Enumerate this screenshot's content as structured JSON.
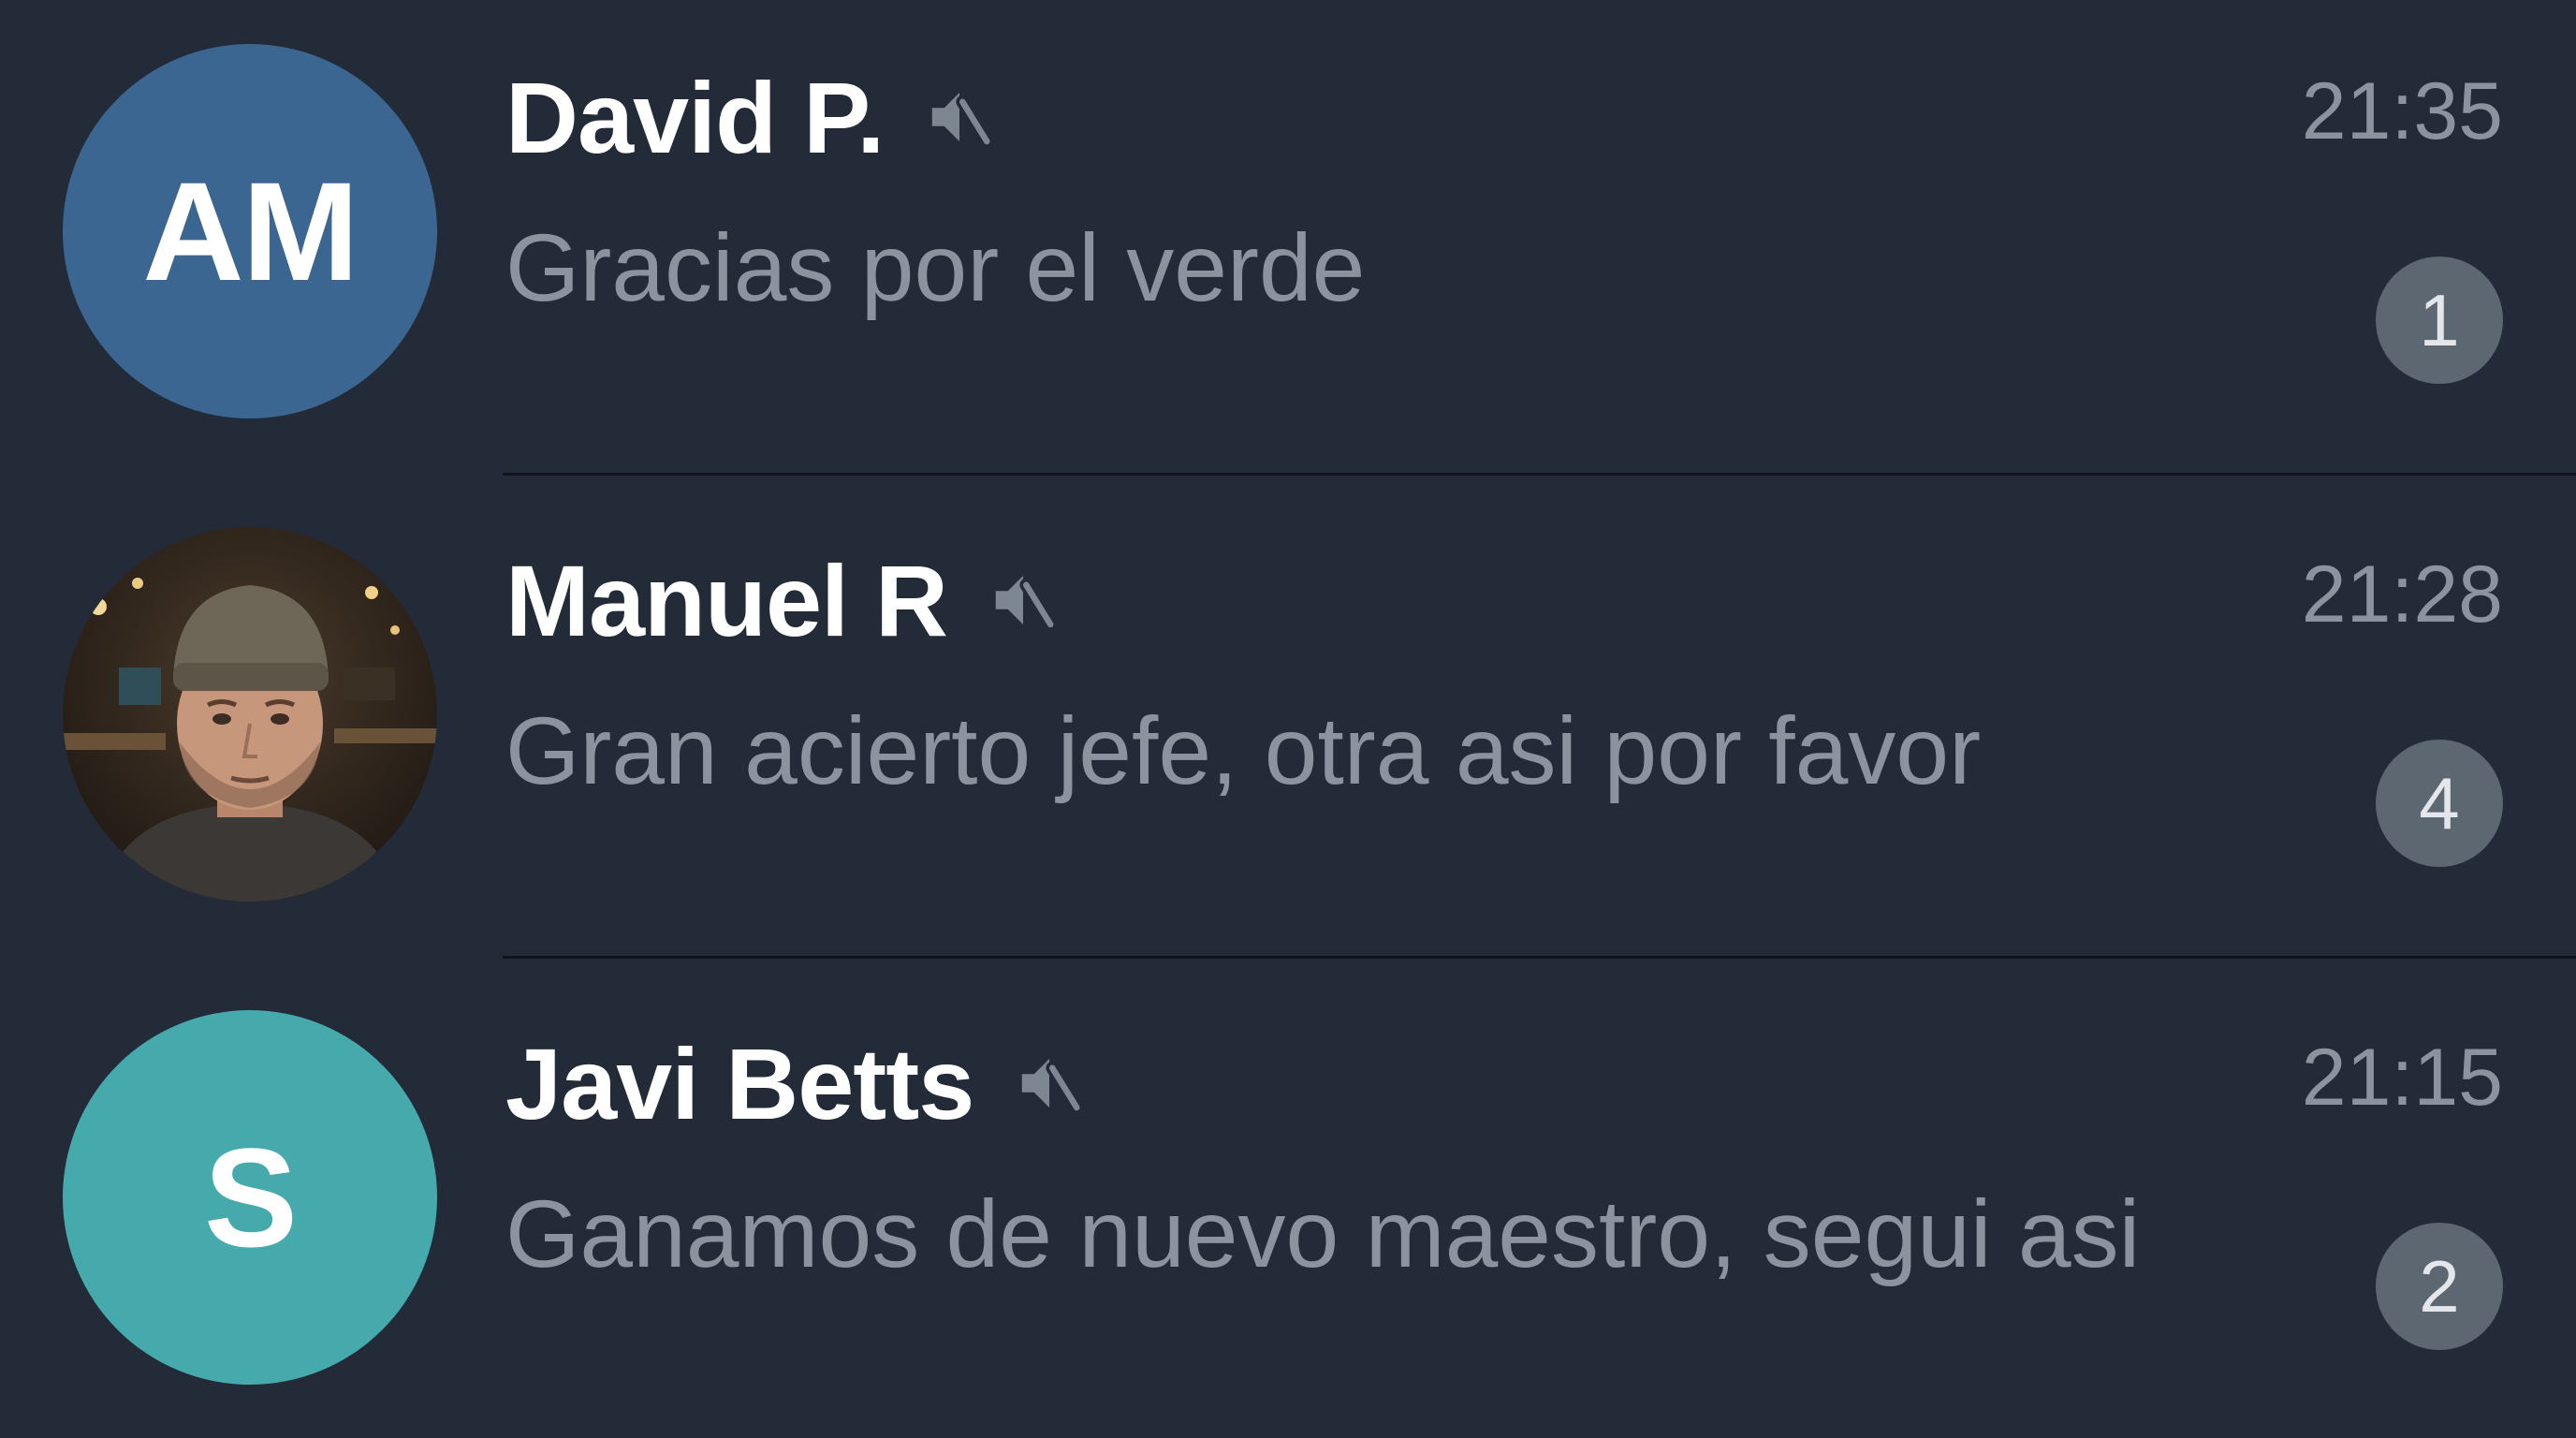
{
  "colors": {
    "background": "#222b37",
    "avatar_blue": "#3c6692",
    "avatar_teal": "#46a9ac",
    "name_text": "#ffffff",
    "secondary_text": "#8b949e",
    "badge_bg": "#5d6771",
    "divider": "#0f151c"
  },
  "chats": [
    {
      "avatar_initials": "AM",
      "avatar_color": "#3c6692",
      "name": "David P.",
      "muted_icon": "muted-speaker-icon",
      "time": "21:35",
      "preview": "Gracias por el verde",
      "unread": "1"
    },
    {
      "avatar_type": "photo",
      "name": "Manuel R",
      "muted_icon": "muted-speaker-icon",
      "time": "21:28",
      "preview": "Gran acierto jefe, otra asi por favor",
      "unread": "4"
    },
    {
      "avatar_initials": "S",
      "avatar_color": "#46a9ac",
      "name": "Javi Betts",
      "muted_icon": "muted-speaker-icon",
      "time": "21:15",
      "preview": "Ganamos de nuevo maestro, segui asi",
      "unread": "2"
    }
  ]
}
